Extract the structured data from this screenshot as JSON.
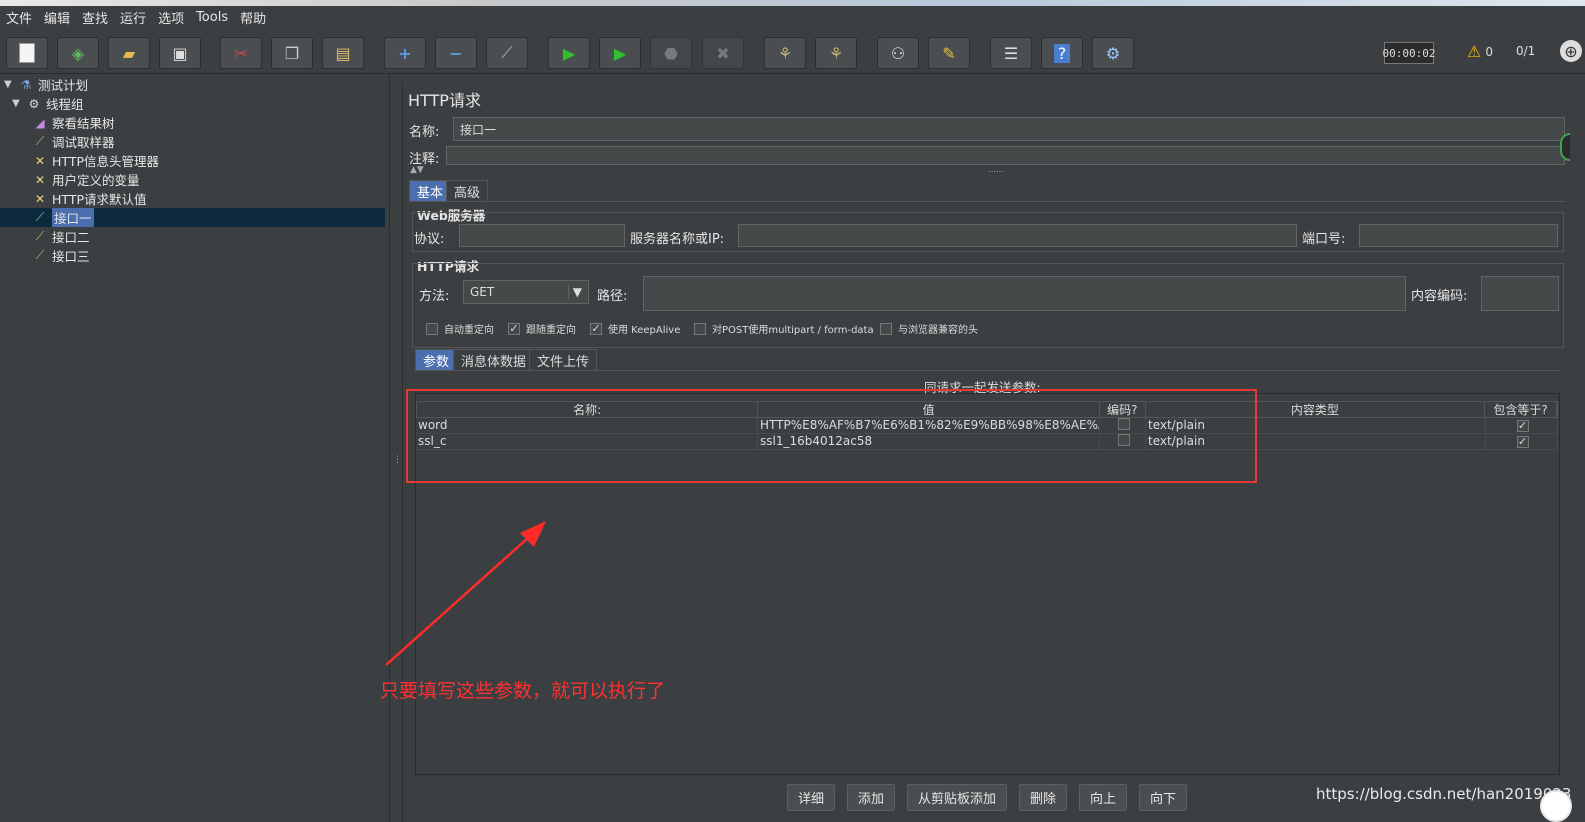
{
  "menu": [
    "文件",
    "编辑",
    "查找",
    "运行",
    "选项",
    "Tools",
    "帮助"
  ],
  "toolbar": {
    "buttons": [
      "new-icon",
      "templates-icon",
      "open-icon",
      "save-icon",
      "cut-icon",
      "copy-icon",
      "paste-icon",
      "expand-icon",
      "collapse-icon",
      "toggle-icon",
      "start-icon",
      "start-no-pause-icon",
      "stop-icon",
      "shutdown-icon",
      "clear-icon",
      "clear-all-icon",
      "search-icon",
      "reset-search-icon",
      "function-helper-icon",
      "help-icon",
      "remote-icon"
    ],
    "timer": "00:00:02",
    "warnings": "0",
    "threads": "0/1"
  },
  "tree": [
    {
      "label": "测试计划",
      "icon": "flask-icon",
      "caret": "▼"
    },
    {
      "label": "线程组",
      "icon": "gear-icon",
      "caret": "▼"
    },
    {
      "label": "察看结果树",
      "icon": "chart-icon",
      "caret": ""
    },
    {
      "label": "调试取样器",
      "icon": "pipette-icon",
      "caret": ""
    },
    {
      "label": "HTTP信息头管理器",
      "icon": "tools-icon",
      "caret": ""
    },
    {
      "label": "用户定义的变量",
      "icon": "tools-icon",
      "caret": ""
    },
    {
      "label": "HTTP请求默认值",
      "icon": "tools-icon",
      "caret": ""
    },
    {
      "label": "接口一",
      "icon": "pipette-icon",
      "caret": "",
      "selected": true
    },
    {
      "label": "接口二",
      "icon": "pipette-icon",
      "caret": ""
    },
    {
      "label": "接口三",
      "icon": "pipette-icon",
      "caret": ""
    }
  ],
  "panel": {
    "title": "HTTP请求",
    "name_label": "名称:",
    "name_value": "接口一",
    "comment_label": "注释:",
    "tabs": [
      "基本",
      "高级"
    ],
    "web_server": {
      "title": "Web服务器",
      "protocol_label": "协议:",
      "server_label": "服务器名称或IP:",
      "port_label": "端口号:"
    },
    "http_request": {
      "title": "HTTP请求",
      "method_label": "方法:",
      "method_value": "GET",
      "path_label": "路径:",
      "encoding_label": "内容编码:"
    },
    "checkboxes": [
      {
        "label": "自动重定向",
        "checked": false
      },
      {
        "label": "跟随重定向",
        "checked": true
      },
      {
        "label": "使用 KeepAlive",
        "checked": true
      },
      {
        "label": "对POST使用multipart / form-data",
        "checked": false
      },
      {
        "label": "与浏览器兼容的头",
        "checked": false
      }
    ],
    "subtabs": [
      "参数",
      "消息体数据",
      "文件上传"
    ],
    "params_caption": "同请求一起发送参数:",
    "table": {
      "headers": [
        "名称:",
        "值",
        "编码?",
        "内容类型",
        "包含等于?"
      ],
      "rows": [
        [
          "word",
          "HTTP%E8%AF%B7%E6%B1%82%E9%BB%98%E8%AE%A...",
          "",
          "text/plain",
          "✓"
        ],
        [
          "ssl_c",
          "ssl1_16b4012ac58",
          "",
          "text/plain",
          "✓"
        ]
      ]
    },
    "buttons": [
      "详细",
      "添加",
      "从剪贴板添加",
      "删除",
      "向上",
      "向下"
    ]
  },
  "annotation": "只要填写这些参数，就可以执行了",
  "watermark": "https://blog.csdn.net/han2019023"
}
